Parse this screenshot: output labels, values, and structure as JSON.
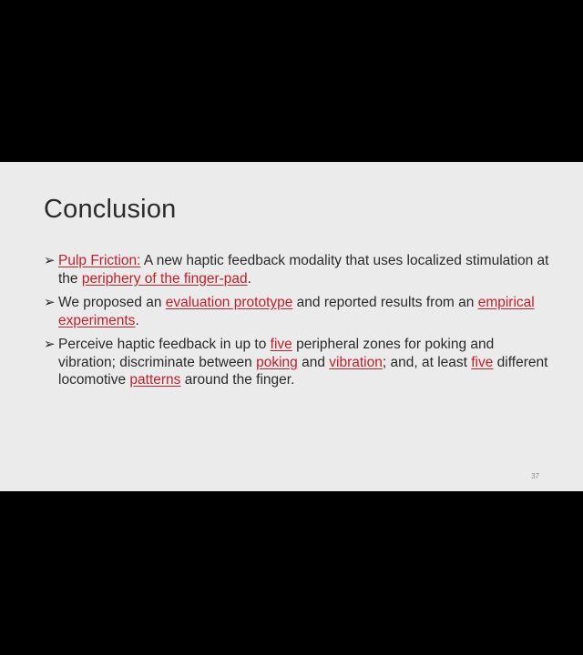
{
  "slide": {
    "title": "Conclusion",
    "bullet_symbol": "➢",
    "page_number": "37",
    "accent_color": "#c0202a",
    "bullets": [
      {
        "parts": [
          {
            "text": "Pulp Friction:",
            "highlight": true
          },
          {
            "text": " A new haptic feedback modality that uses localized stimulation at the ",
            "highlight": false
          },
          {
            "text": "periphery of the finger-pad",
            "highlight": true
          },
          {
            "text": ".",
            "highlight": false
          }
        ]
      },
      {
        "parts": [
          {
            "text": "We proposed an ",
            "highlight": false
          },
          {
            "text": "evaluation prototype",
            "highlight": true
          },
          {
            "text": " and reported results from an ",
            "highlight": false
          },
          {
            "text": "empirical experiments",
            "highlight": true
          },
          {
            "text": ".",
            "highlight": false
          }
        ]
      },
      {
        "parts": [
          {
            "text": "Perceive haptic feedback in up to ",
            "highlight": false
          },
          {
            "text": "five",
            "highlight": true
          },
          {
            "text": " peripheral zones for poking and vibration; discriminate between ",
            "highlight": false
          },
          {
            "text": "poking",
            "highlight": true
          },
          {
            "text": " and ",
            "highlight": false
          },
          {
            "text": "vibration",
            "highlight": true
          },
          {
            "text": "; and, at least ",
            "highlight": false
          },
          {
            "text": "five",
            "highlight": true
          },
          {
            "text": " different locomotive ",
            "highlight": false
          },
          {
            "text": "patterns",
            "highlight": true
          },
          {
            "text": " around the finger.",
            "highlight": false
          }
        ]
      }
    ]
  }
}
